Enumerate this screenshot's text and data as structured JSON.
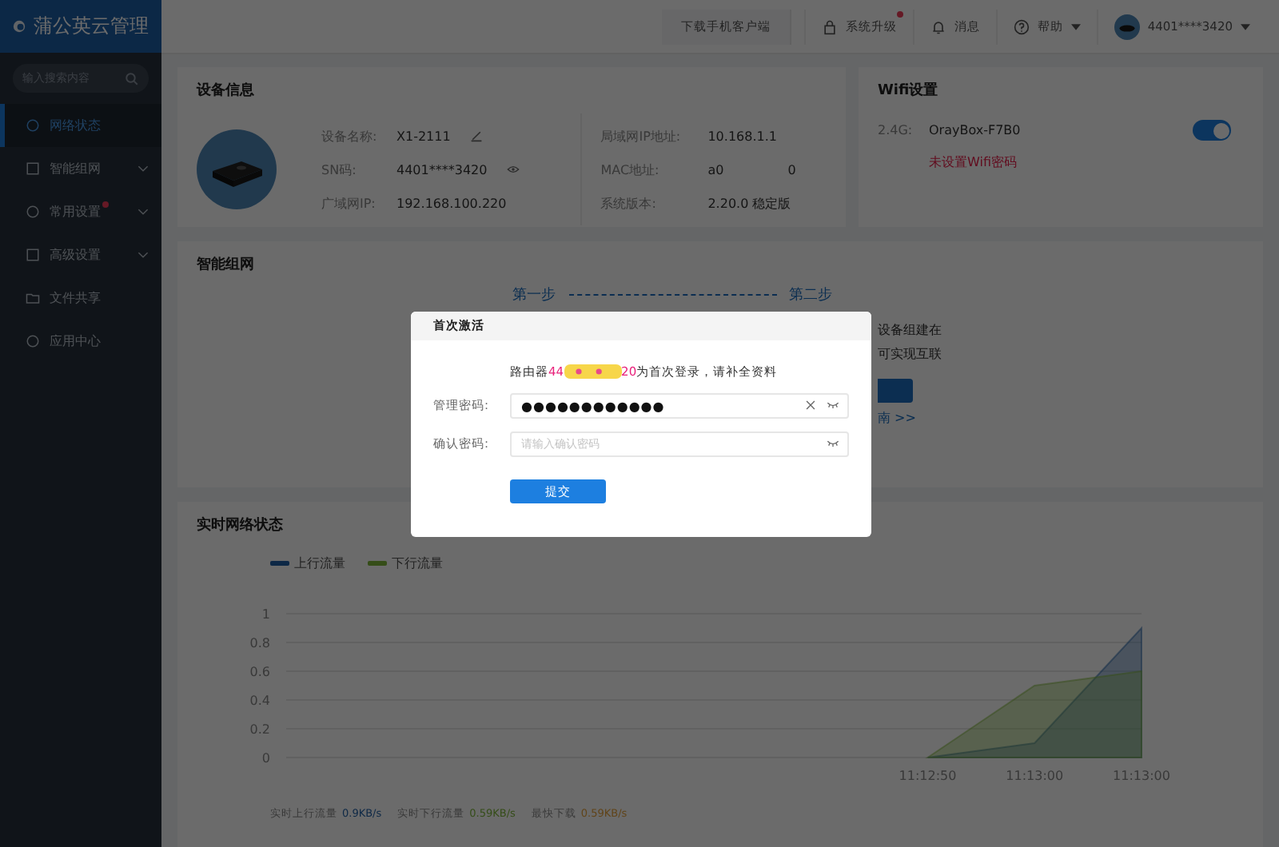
{
  "sidebar": {
    "logo": "蒲公英云管理",
    "search": {
      "placeholder": "输入搜索内容"
    },
    "items": [
      {
        "label": "网络状态",
        "selected": true,
        "expandable": false,
        "dot": false
      },
      {
        "label": "智能组网",
        "selected": false,
        "expandable": true,
        "dot": false
      },
      {
        "label": "常用设置",
        "selected": false,
        "expandable": true,
        "dot": true
      },
      {
        "label": "高级设置",
        "selected": false,
        "expandable": true,
        "dot": false
      },
      {
        "label": "文件共享",
        "selected": false,
        "expandable": false,
        "dot": false
      },
      {
        "label": "应用中心",
        "selected": false,
        "expandable": false,
        "dot": false
      }
    ]
  },
  "topbar": {
    "download": "下载手机客户端",
    "upgrade": "系统升级",
    "upgrade_dot": true,
    "messages": "消息",
    "help": "帮助",
    "account": "4401****3420"
  },
  "device_info": {
    "title": "设备信息",
    "left": [
      {
        "label": "设备名称:",
        "value": "X1-2111",
        "kind": "edit"
      },
      {
        "label": "SN码:",
        "value": "4401****3420",
        "kind": "eye"
      },
      {
        "label": "广域网IP:",
        "value": "192.168.100.220",
        "kind": "plain"
      }
    ],
    "right": [
      {
        "label": "局域网IP地址:",
        "value": "10.168.1.1"
      },
      {
        "label": "MAC地址:",
        "value": "a0",
        "extra": "0"
      },
      {
        "label": "系统版本:",
        "value": "2.20.0 稳定版"
      }
    ]
  },
  "wifi": {
    "title": "Wifi设置",
    "band": "2.4G:",
    "ssid": "OrayBox-F7B0",
    "on": true,
    "warning": "未设置Wifi密码"
  },
  "smart_network": {
    "title": "智能组网",
    "step1": "第一步",
    "step2": "第二步",
    "lines": [
      "设备组建在",
      "可实现互联"
    ],
    "link": "南 >>"
  },
  "traffic": {
    "title": "实时网络状态",
    "chart_data": {
      "type": "area",
      "grid": true,
      "categories": [
        null,
        null,
        null,
        null,
        null,
        null,
        null,
        null,
        null,
        null,
        null,
        null,
        "11:12:50",
        null,
        "11:13:00",
        null,
        "11:13:00"
      ],
      "ylim": [
        0,
        1
      ],
      "yticks": [
        0,
        0.2,
        0.4,
        0.6,
        0.8,
        1
      ],
      "series": [
        {
          "name": "上行流量",
          "color": "#1f5fa6",
          "values": [
            null,
            null,
            null,
            null,
            null,
            null,
            null,
            null,
            null,
            null,
            null,
            null,
            0,
            0.05,
            0.1,
            0.5,
            0.9
          ]
        },
        {
          "name": "下行流量",
          "color": "#7fb83a",
          "values": [
            null,
            null,
            null,
            null,
            null,
            null,
            null,
            null,
            null,
            null,
            null,
            null,
            0,
            0.25,
            0.5,
            0.55,
            0.6
          ]
        }
      ]
    },
    "stats": [
      {
        "label": "实时上行流量",
        "value": "0.9KB/s",
        "color": "#0d2846"
      },
      {
        "label": "实时下行流量",
        "value": "0.59KB/s",
        "color": "#354d18"
      },
      {
        "label": "最快下载",
        "value": "0.59KB/s",
        "color": "#614419"
      }
    ]
  },
  "dialog": {
    "title": "首次激活",
    "msg_prefix": "路由器 ",
    "id_start": "44",
    "id_end": "20",
    "msg_suffix": " 为首次登录，请补全资料",
    "fields": [
      {
        "label": "管理密码:",
        "value": "●●●●●●●●●●●●",
        "clearable": true
      },
      {
        "label": "确认密码:",
        "placeholder": "请输入确认密码",
        "clearable": false
      }
    ],
    "submit": "提交"
  }
}
